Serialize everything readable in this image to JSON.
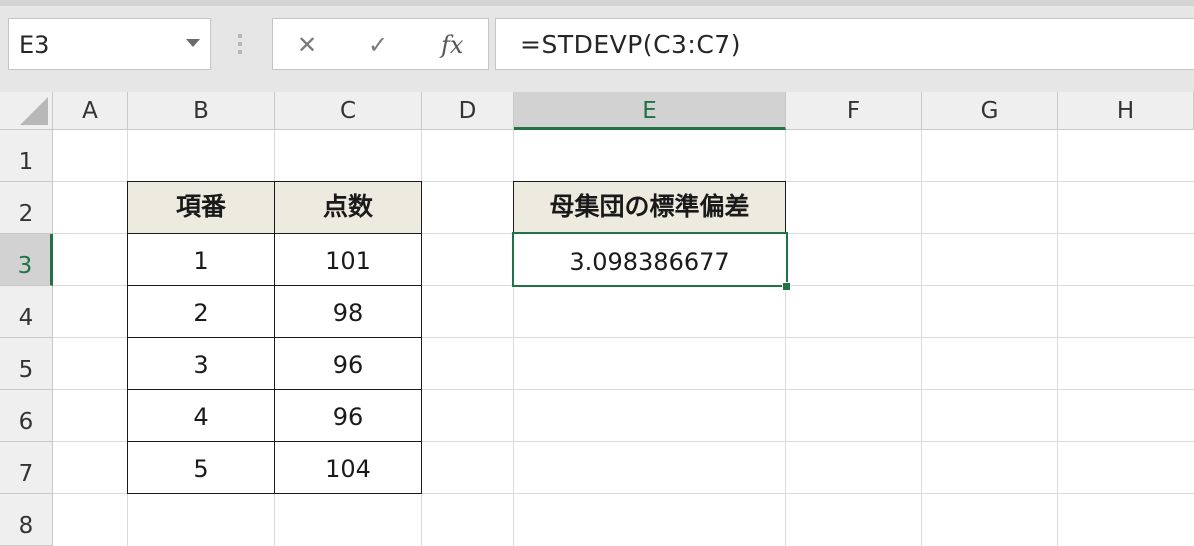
{
  "name_box": {
    "value": "E3"
  },
  "formula_bar": {
    "cancel_icon": "✕",
    "enter_icon": "✓",
    "fx_label": "fx",
    "formula": "=STDEVP(C3:C7)"
  },
  "columns": [
    "A",
    "B",
    "C",
    "D",
    "E",
    "F",
    "G",
    "H"
  ],
  "rows": [
    "1",
    "2",
    "3",
    "4",
    "5",
    "6",
    "7",
    "8"
  ],
  "selected": {
    "column": "E",
    "row": "3"
  },
  "table": {
    "headers": [
      "項番",
      "点数"
    ],
    "rows": [
      [
        "1",
        "101"
      ],
      [
        "2",
        "98"
      ],
      [
        "3",
        "96"
      ],
      [
        "4",
        "96"
      ],
      [
        "5",
        "104"
      ]
    ]
  },
  "result": {
    "header": "母集団の標準偏差",
    "value": "3.098386677"
  },
  "colors": {
    "accent": "#217346",
    "header_fill": "#edebe0"
  }
}
